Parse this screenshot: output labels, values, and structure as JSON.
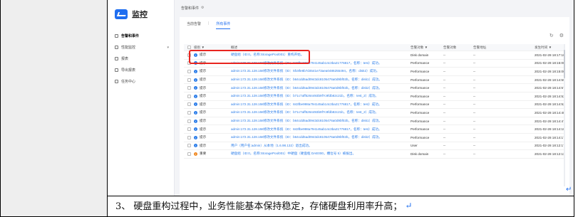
{
  "app": {
    "brand": "监控",
    "breadcrumb": "告警和事件",
    "gear_icon": "gear-icon"
  },
  "sidebar": {
    "items": [
      {
        "label": "告警和事件",
        "icon": "bell-icon",
        "active": true
      },
      {
        "label": "性能监控",
        "icon": "chart-icon",
        "expandable": true
      },
      {
        "label": "报表",
        "icon": "report-icon"
      },
      {
        "label": "导出报表",
        "icon": "export-icon"
      },
      {
        "label": "任务中心",
        "icon": "task-icon"
      }
    ]
  },
  "tabs": [
    {
      "label": "当前告警",
      "active": false
    },
    {
      "label": "所有事件",
      "active": true
    }
  ],
  "tabs_separator": "|",
  "toolbar": {
    "refresh_icon": "↻",
    "settings_icon": "⚙"
  },
  "table": {
    "headers": [
      "级别 ▼",
      "概述",
      "告警对象 ▼",
      "告警对象",
      "告警地址",
      "发生时间 ▼"
    ],
    "rows": [
      {
        "level": "提示",
        "level_color": "#2b7de9",
        "summary": "硬盘组（ID:0，名称:StoragePool001）重构开始。",
        "type": "Disk domain",
        "obj": "--",
        "addr": "--",
        "time": "2021-02-28 18:17:10",
        "highlight": true
      },
      {
        "level": "提示",
        "level_color": "#2b7de9",
        "summary": "admin:172.31.128.158修改文件系统（ID：843fbe998a794145ab14c3ba21776817，名称：test）成功。",
        "type": "Performance",
        "obj": "--",
        "addr": "--",
        "time": "2021-02-28 18:15:06"
      },
      {
        "level": "提示",
        "level_color": "#2b7de9",
        "summary": "admin:172.31.128.158修改文件系统（ID：5fc8fe8b7d4541e73aea0486255494，名称：disk2）成功。",
        "type": "Performance",
        "obj": "--",
        "addr": "--",
        "time": "2021-02-28 18:15:00"
      },
      {
        "level": "提示",
        "level_color": "#2b7de9",
        "summary": "admin:172.31.128.158修改文件系统（ID：b64cdd5ad0943dc8105476a0d9bf02b，名称：disk1）成功。",
        "type": "Performance",
        "obj": "--",
        "addr": "--",
        "time": "2021-02-28 18:14:59"
      },
      {
        "level": "提示",
        "level_color": "#2b7de9",
        "summary": "admin:172.31.128.158修改文件系统（ID：b64cdd5ad0943dc8105476a0d9bf02b，名称：disk2）成功。",
        "type": "Performance",
        "obj": "--",
        "addr": "--",
        "time": "2021-02-28 18:14:57"
      },
      {
        "level": "提示",
        "level_color": "#2b7de9",
        "summary": "admin:172.31.128.158修改文件系统（ID：b71c7aff5264493b9f7c9fdb82c21b，名称：test_2）成功。",
        "type": "Performance",
        "obj": "--",
        "addr": "--",
        "time": "2021-02-28 18:14:53"
      },
      {
        "level": "提示",
        "level_color": "#2b7de9",
        "summary": "admin:172.31.128.158修改文件系统（ID：843fbe998a794145ab14c3ba21776817，名称：test）成功。",
        "type": "Performance",
        "obj": "--",
        "addr": "--",
        "time": "2021-02-28 18:14:52"
      },
      {
        "level": "提示",
        "level_color": "#2b7de9",
        "summary": "admin:172.31.128.158修改文件系统（ID：b71c7aff5264493b9f7c9fdb82c21b，名称：test_2）成功。",
        "type": "Performance",
        "obj": "--",
        "addr": "--",
        "time": "2021-02-28 18:14:48"
      },
      {
        "level": "提示",
        "level_color": "#2b7de9",
        "summary": "admin:172.31.128.158修改文件系统（ID：b64cdd5ad0943dc8105476a0d9bf02b，名称：disk1）成功。",
        "type": "Performance",
        "obj": "--",
        "addr": "--",
        "time": "2021-02-28 18:14:47"
      },
      {
        "level": "提示",
        "level_color": "#2b7de9",
        "summary": "admin:172.31.128.158修改文件系统（ID：843fbe998a794145ab14c3ba21776817，名称：test）成功。",
        "type": "Performance",
        "obj": "--",
        "addr": "--",
        "time": "2021-02-28 18:14:18"
      },
      {
        "level": "提示",
        "level_color": "#2b7de9",
        "summary": "admin:172.31.128.158修改文件系统（ID：b64cdd5ad0943dc8105476a0d9bf02b，名称：disk2）成功。",
        "type": "Performance",
        "obj": "--",
        "addr": "--",
        "time": "2021-02-28 18:14:17"
      },
      {
        "level": "提示",
        "level_color": "#2b7de9",
        "summary": "用户（用户名:admin）从本地（1.6.98.132）退出成功。",
        "type": "User",
        "obj": "--",
        "addr": "--",
        "time": "2021-02-28 18:12:17"
      },
      {
        "level": "重要",
        "level_color": "#f08a24",
        "summary": "硬盘组（ID:0，名称:StoragePool001）中硬盘（硬盘框 DAE000，槽位号 5）被拔出。",
        "type": "Disk domain",
        "obj": "--",
        "addr": "--",
        "time": "2021-02-28 18:12:11"
      }
    ]
  },
  "caption": {
    "text": "3、 硬盘重构过程中，业务性能基本保持稳定，存储硬盘利用率升高；",
    "return_mark": "↵"
  }
}
